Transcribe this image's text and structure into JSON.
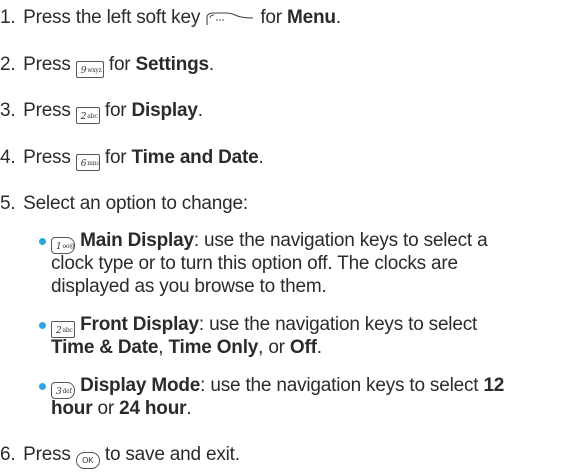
{
  "steps": [
    {
      "num": "1.",
      "pre": "Press the left soft key",
      "mid": "for",
      "bold": "Menu",
      "post": "."
    },
    {
      "num": "2.",
      "pre": "Press",
      "key": "9wxyz",
      "mid": "for",
      "bold": "Settings",
      "post": "."
    },
    {
      "num": "3.",
      "pre": "Press",
      "key": "2abc",
      "mid": "for",
      "bold": "Display",
      "post": "."
    },
    {
      "num": "4.",
      "pre": "Press",
      "key": "6mno",
      "mid": "for",
      "bold": "Time and Date",
      "post": "."
    },
    {
      "num": "5.",
      "text": "Select an option to change:"
    },
    {
      "num": "6.",
      "pre": "Press",
      "key": "OK",
      "post": "to save and exit."
    }
  ],
  "options": [
    {
      "key": "1",
      "title": "Main Display",
      "lines": [
        ": use the navigation keys to select a",
        "clock type or to turn this option off. The clocks are",
        "displayed as you browse to them."
      ]
    },
    {
      "key": "2",
      "title": "Front Display",
      "lines": [
        ": use the navigation keys to select",
        "",
        ", ",
        ", or ",
        "."
      ],
      "bold_items": [
        "Time & Date",
        "Time Only",
        "Off"
      ]
    },
    {
      "key": "3",
      "title": "Display Mode",
      "lines": [
        ": use the navigation keys to select",
        " or ",
        "."
      ],
      "bold_items": [
        "12",
        "hour",
        "24 hour"
      ]
    }
  ],
  "colors": {
    "bullet": "#2aa7e0",
    "text": "#2b2b2b"
  }
}
